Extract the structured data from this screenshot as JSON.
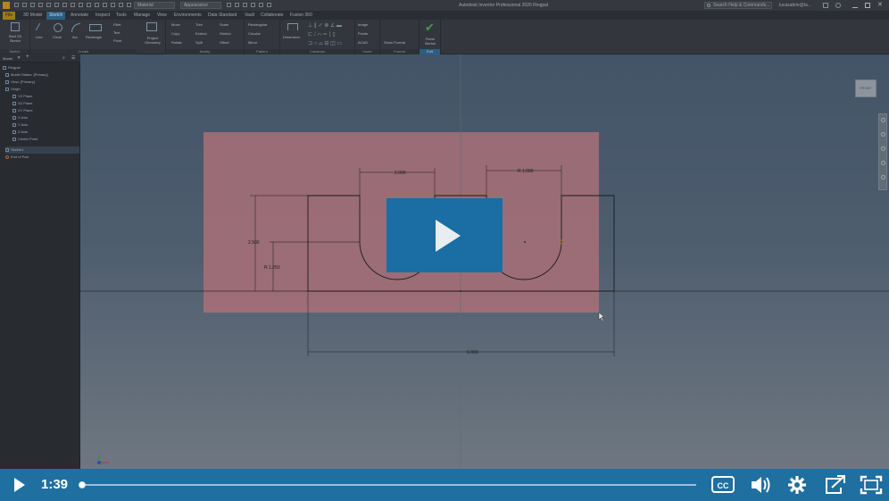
{
  "window": {
    "title": "Autodesk Inventor Professional 2026 Ringpal",
    "material": "Material",
    "appearance": "Appearance",
    "search_placeholder": "Search Help & Commands...",
    "user": "lucasabrie@la..."
  },
  "ribbon_tabs": [
    "File",
    "3D Model",
    "Sketch",
    "Annotate",
    "Inspect",
    "Tools",
    "Manage",
    "View",
    "Environments",
    "Data Standard",
    "Vault",
    "Collaborate",
    "Fusion 360"
  ],
  "active_tab": "Sketch",
  "ribbon": {
    "sketch": {
      "start_2d_sketch": "Start 2D Sketch",
      "label": "Sketch"
    },
    "create": {
      "line": "Line",
      "circle": "Circle",
      "arc": "Arc",
      "rectangle": "Rectangle",
      "fillet": "Fillet",
      "text": "Text",
      "point": "Point",
      "label": "Create"
    },
    "project_geometry": "Project Geometry",
    "modify": {
      "move": "Move",
      "trim": "Trim",
      "scale": "Scale",
      "copy": "Copy",
      "extend": "Extend",
      "stretch": "Stretch",
      "rotate": "Rotate",
      "split": "Split",
      "offset": "Offset",
      "label": "Modify"
    },
    "pattern": {
      "rectangular": "Rectangular",
      "circular": "Circular",
      "mirror": "Mirror",
      "label": "Pattern"
    },
    "constrain": {
      "dimension": "Dimension",
      "label": "Constrain"
    },
    "insert": {
      "image": "Image",
      "points": "Points",
      "acad": "ACAD",
      "label": "Insert"
    },
    "format": {
      "show_format": "Show Format",
      "label": "Format"
    },
    "exit": {
      "finish_sketch": "Finish Sketch",
      "label": "Exit"
    }
  },
  "browser": {
    "tab_label": "Model",
    "nodes": [
      "Ringpal",
      "Model States: [Primary]",
      "View: [Primary]",
      "Origin",
      "YZ Plane",
      "XZ Plane",
      "XY Plane",
      "X Axis",
      "Y Axis",
      "Z Axis",
      "Center Point",
      "Sketch1",
      "End of Part"
    ]
  },
  "viewport": {
    "viewcube_label": "FRONT",
    "dimensions": [
      "2.000",
      "R 1.000",
      "2.500",
      "R 1.250",
      "6.000"
    ]
  },
  "player": {
    "time": "1:39",
    "progress": 0.0,
    "cc_label": "CC"
  },
  "colors": {
    "accent": "#1f6fa0",
    "big_play": "#1a6ea3",
    "pink_region": "#c98088"
  }
}
